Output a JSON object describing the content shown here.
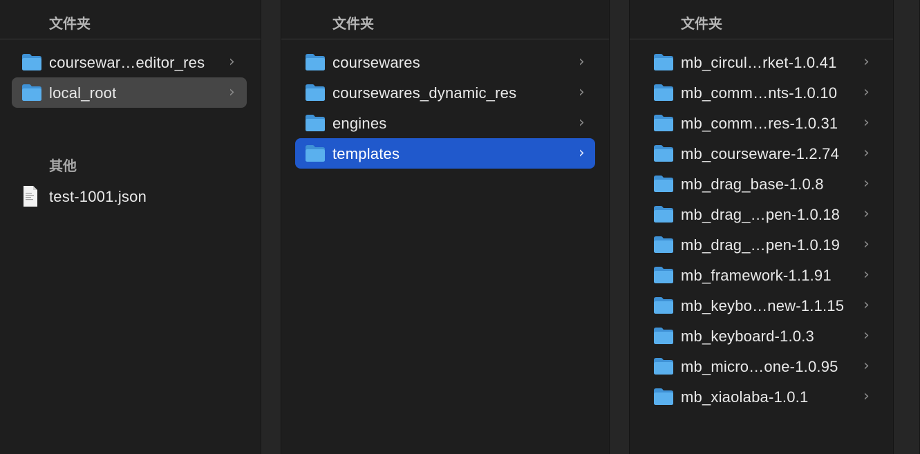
{
  "columns": [
    {
      "header": "文件夹",
      "items": [
        {
          "name": "coursewar…editor_res",
          "type": "folder",
          "selected": false
        },
        {
          "name": "local_root",
          "type": "folder",
          "selected": true
        }
      ],
      "other_section_label": "其他",
      "other_items": [
        {
          "name": "test-1001.json",
          "type": "file"
        }
      ]
    },
    {
      "header": "文件夹",
      "items": [
        {
          "name": "coursewares",
          "type": "folder"
        },
        {
          "name": "coursewares_dynamic_res",
          "type": "folder"
        },
        {
          "name": "engines",
          "type": "folder"
        },
        {
          "name": "templates",
          "type": "folder",
          "selected": true
        }
      ]
    },
    {
      "header": "文件夹",
      "items": [
        {
          "name": "mb_circul…rket-1.0.41",
          "type": "folder"
        },
        {
          "name": "mb_comm…nts-1.0.10",
          "type": "folder"
        },
        {
          "name": "mb_comm…res-1.0.31",
          "type": "folder"
        },
        {
          "name": "mb_courseware-1.2.74",
          "type": "folder"
        },
        {
          "name": "mb_drag_base-1.0.8",
          "type": "folder"
        },
        {
          "name": "mb_drag_…pen-1.0.18",
          "type": "folder"
        },
        {
          "name": "mb_drag_…pen-1.0.19",
          "type": "folder"
        },
        {
          "name": "mb_framework-1.1.91",
          "type": "folder"
        },
        {
          "name": "mb_keybo…new-1.1.15",
          "type": "folder"
        },
        {
          "name": "mb_keyboard-1.0.3",
          "type": "folder"
        },
        {
          "name": "mb_micro…one-1.0.95",
          "type": "folder"
        },
        {
          "name": "mb_xiaolaba-1.0.1",
          "type": "folder"
        }
      ]
    }
  ],
  "icons": {
    "folder": "folder-icon",
    "file": "json-file-icon",
    "disclosure": "chevron-right-icon"
  },
  "chevron_glyph": "›",
  "colors": {
    "selection_blue": "#2059cc",
    "selection_gray": "#464646",
    "folder_blue": "#5ab0ee"
  }
}
